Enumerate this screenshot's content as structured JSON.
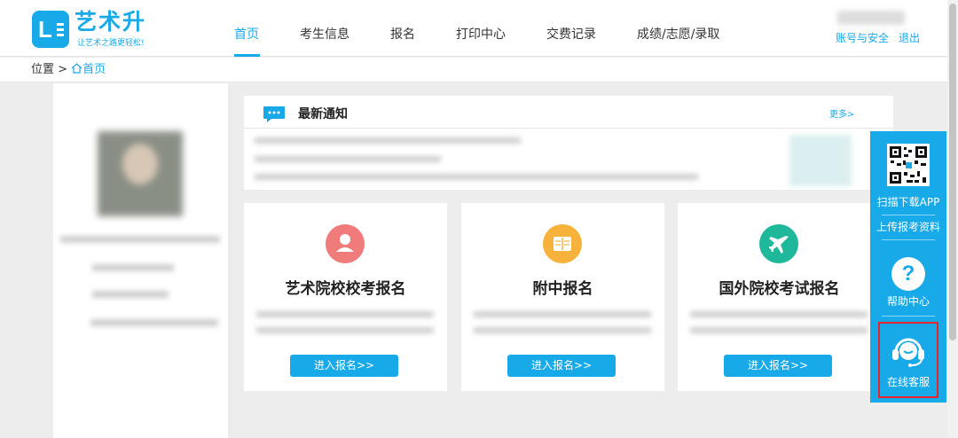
{
  "header": {
    "brand_title": "艺术升",
    "brand_tagline": "让艺术之路更轻松!",
    "nav": [
      {
        "label": "首页",
        "active": true
      },
      {
        "label": "考生信息",
        "active": false
      },
      {
        "label": "报名",
        "active": false
      },
      {
        "label": "打印中心",
        "active": false
      },
      {
        "label": "交费记录",
        "active": false
      },
      {
        "label": "成绩/志愿/录取",
        "active": false
      }
    ],
    "account_label": "账号与安全",
    "logout_label": "退出"
  },
  "breadcrumb": {
    "prefix": "位置 >",
    "current": "首页"
  },
  "notice": {
    "title": "最新通知",
    "more_label": "更多>"
  },
  "cards": [
    {
      "title": "艺术院校校考报名",
      "button_label": "进入报名>>",
      "icon": "user-icon",
      "color": "#f07b7b"
    },
    {
      "title": "附中报名",
      "button_label": "进入报名>>",
      "icon": "book-icon",
      "color": "#f7b23b"
    },
    {
      "title": "国外院校考试报名",
      "button_label": "进入报名>>",
      "icon": "plane-icon",
      "color": "#1fb89a"
    }
  ],
  "float_panel": {
    "scan_label": "扫描下载APP",
    "upload_label": "上传报考资料",
    "help_label": "帮助中心",
    "service_label": "在线客服"
  },
  "colors": {
    "accent": "#17a9e8",
    "highlight_border": "#e8242a"
  }
}
